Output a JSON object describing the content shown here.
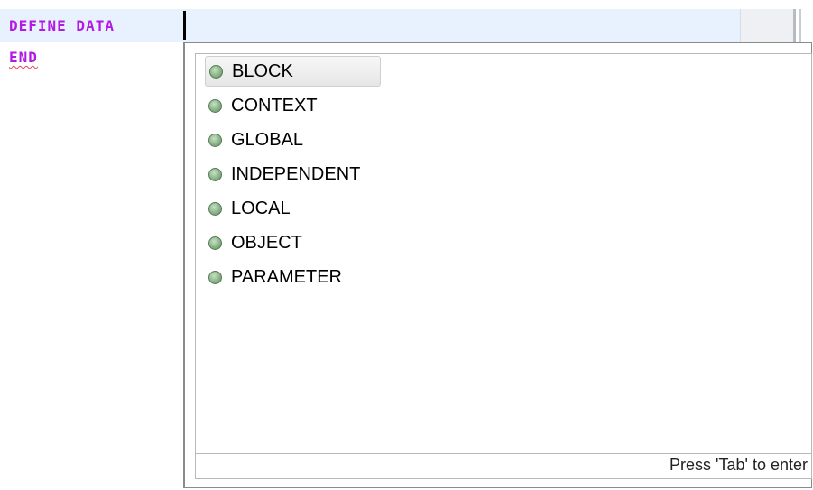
{
  "editor": {
    "lines": [
      "DEFINE DATA",
      "END"
    ],
    "colors": {
      "keyword": "#b21be3",
      "current_line": "#e8f2fe",
      "error_underline": "#e5445c"
    }
  },
  "content_assist": {
    "proposals": [
      {
        "label": "BLOCK",
        "icon": "green-dot-icon",
        "selected": true
      },
      {
        "label": "CONTEXT",
        "icon": "green-dot-icon",
        "selected": false
      },
      {
        "label": "GLOBAL",
        "icon": "green-dot-icon",
        "selected": false
      },
      {
        "label": "INDEPENDENT",
        "icon": "green-dot-icon",
        "selected": false
      },
      {
        "label": "LOCAL",
        "icon": "green-dot-icon",
        "selected": false
      },
      {
        "label": "OBJECT",
        "icon": "green-dot-icon",
        "selected": false
      },
      {
        "label": "PARAMETER",
        "icon": "green-dot-icon",
        "selected": false
      }
    ],
    "status_text": "Press 'Tab' to enter"
  }
}
